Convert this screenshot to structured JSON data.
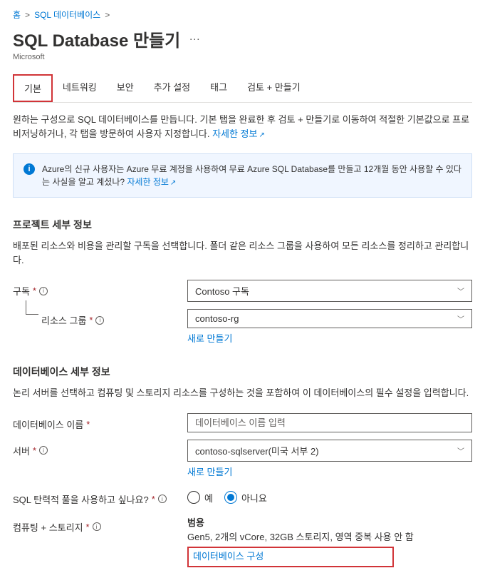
{
  "breadcrumb": {
    "home": "홈",
    "database": "SQL 데이터베이스"
  },
  "header": {
    "title": "SQL Database 만들기",
    "subtitle": "Microsoft"
  },
  "tabs": [
    {
      "label": "기본",
      "active": true
    },
    {
      "label": "네트워킹",
      "active": false
    },
    {
      "label": "보안",
      "active": false
    },
    {
      "label": "추가 설정",
      "active": false
    },
    {
      "label": "태그",
      "active": false
    },
    {
      "label": "검토 + 만들기",
      "active": false
    }
  ],
  "description": {
    "text": "원하는 구성으로 SQL 데이터베이스를 만듭니다. 기본 탭을 완료한 후 검토 + 만들기로 이동하여 적절한 기본값으로 프로비저닝하거나, 각 탭을 방문하여 사용자 지정합니다. ",
    "link": "자세한 정보"
  },
  "infoBox": {
    "text": "Azure의 신규 사용자는 Azure 무료 계정을 사용하여 무료 Azure SQL Database를 만들고 12개월 동안 사용할 수 있다는 사실을 알고 계셨나? ",
    "link": "자세한 정보"
  },
  "sections": {
    "project": {
      "title": "프로젝트 세부 정보",
      "desc": "배포된 리소스와 비용을 관리할 구독을 선택합니다. 폴더 같은 리소스 그룹을 사용하여 모든 리소스를 정리하고 관리합니다.",
      "fields": {
        "subscription": {
          "label": "구독",
          "value": "Contoso 구독"
        },
        "resourceGroup": {
          "label": "리소스 그룹",
          "value": "contoso-rg",
          "createLink": "새로 만들기"
        }
      }
    },
    "database": {
      "title": "데이터베이스 세부 정보",
      "desc": "논리 서버를 선택하고 컴퓨팅 및 스토리지 리소스를 구성하는 것을 포함하여 이 데이터베이스의 필수 설정을 입력합니다.",
      "fields": {
        "name": {
          "label": "데이터베이스 이름",
          "placeholder": "데이터베이스 이름 입력"
        },
        "server": {
          "label": "서버",
          "value": "contoso-sqlserver(미국 서부 2)",
          "createLink": "새로 만들기"
        },
        "elasticPool": {
          "label": "SQL 탄력적 풀을 사용하고 싶나요?",
          "options": {
            "yes": "예",
            "no": "아니요"
          },
          "selected": "no"
        },
        "compute": {
          "label": "컴퓨팅 + 스토리지",
          "tier": "범용",
          "details": "Gen5, 2개의 vCore, 32GB 스토리지, 영역 중복 사용 안 함",
          "configureLink": "데이터베이스 구성"
        }
      }
    }
  }
}
